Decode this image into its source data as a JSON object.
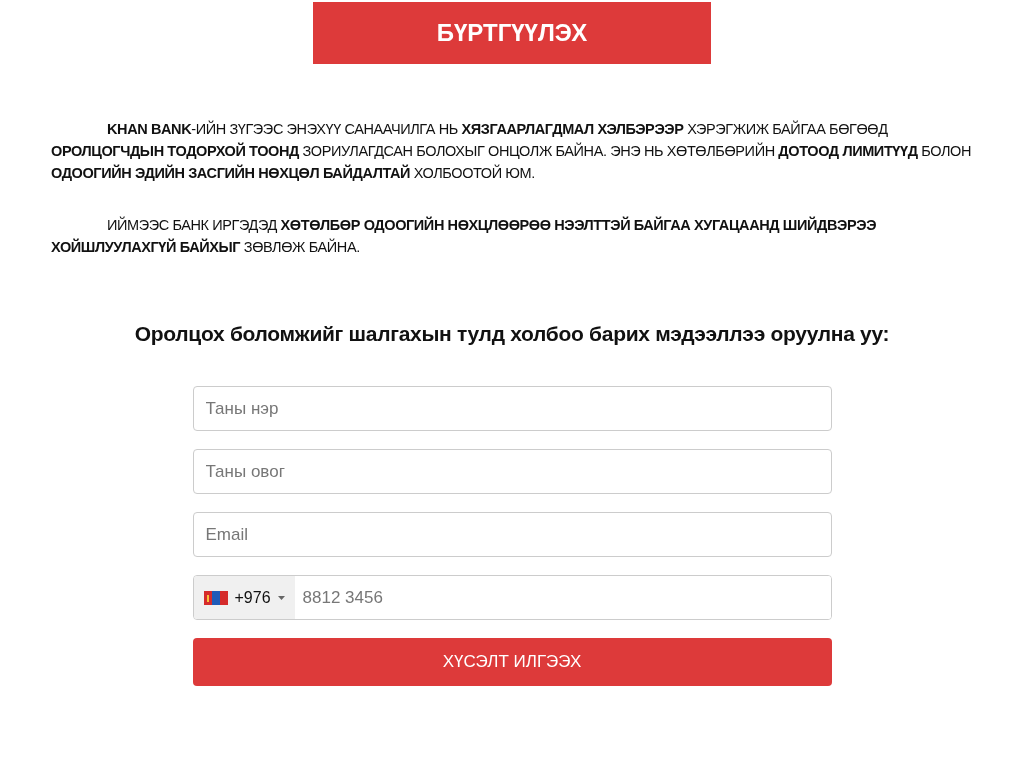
{
  "banner": {
    "title": "БҮРТГҮҮЛЭХ"
  },
  "paragraphs": [
    "**KHAN BANK**-ИЙН ЗҮГЭЭС ЭНЭХҮҮ САНААЧИЛГА НЬ **ХЯЗГААРЛАГДМАЛ ХЭЛБЭРЭЭР** ХЭРЭГЖИЖ БАЙГАА БӨГӨӨД **ОРОЛЦОГЧДЫН ТОДОРХОЙ ТООНД** ЗОРИУЛАГДСАН БОЛОХЫГ ОНЦОЛЖ БАЙНА. ЭНЭ НЬ ХӨТӨЛБӨРИЙН **ДОТООД ЛИМИТҮҮД** БОЛОН **ОДООГИЙН ЭДИЙН ЗАСГИЙН НӨХЦӨЛ БАЙДАЛТАЙ** ХОЛБООТОЙ ЮМ.",
    "ИЙМЭЭС БАНК ИРГЭДЭД **ХӨТӨЛБӨР ОДООГИЙН НӨХЦЛӨӨРӨӨ НЭЭЛТТЭЙ БАЙГАА ХУГАЦААНД ШИЙДВЭРЭЭ ХОЙШЛУУЛАХГҮЙ БАЙХЫГ** ЗӨВЛӨЖ БАЙНА."
  ],
  "form": {
    "heading": "Оролцох боломжийг шалгахын тулд холбоо барих мэдээллээ оруулна уу:",
    "fields": [
      {
        "placeholder": "Таны нэр"
      },
      {
        "placeholder": "Таны овог"
      },
      {
        "placeholder": "Email"
      }
    ],
    "phone": {
      "code": "+976",
      "placeholder": "8812 3456"
    },
    "submit": "ХҮСЭЛТ ИЛГЭЭХ"
  }
}
